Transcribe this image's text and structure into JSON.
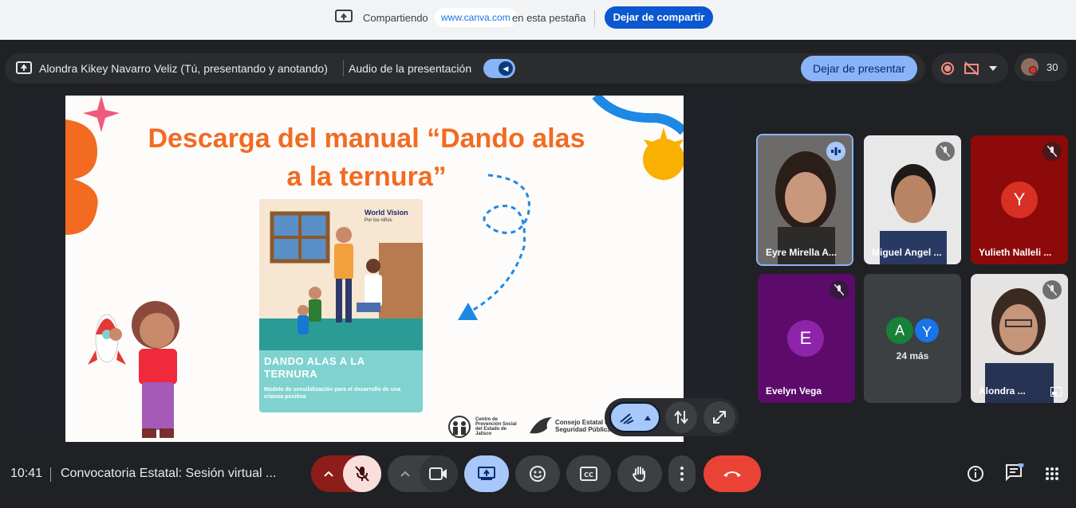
{
  "share_bar": {
    "label": "Compartiendo",
    "domain": "www.canva.com",
    "suffix": "en esta pestaña",
    "stop_button": "Dejar de compartir"
  },
  "present_bar": {
    "presenter": "Alondra Kikey Navarro Veliz (Tú, presentando y anotando)",
    "audio_label": "Audio de la presentación",
    "audio_on": true,
    "stop_button": "Dejar de presentar"
  },
  "participants_count": "30",
  "slide": {
    "title": "Descarga del manual “Dando alas a la ternura”",
    "book_brand": "World Vision",
    "book_brand_sub": "Por los niños",
    "book_title": "DANDO ALAS A LA TERNURA",
    "book_subtitle": "Modelo de sensibilización para el desarrollo de una crianza positiva",
    "logo_a": "Centro de Prevención Social del Estado de Jalisco",
    "logo_b": "Consejo Estatal de Seguridad Pública"
  },
  "tiles": [
    {
      "name": "Eyre Mirella A...",
      "state": "speaking"
    },
    {
      "name": "Miguel Angel ...",
      "state": "muted"
    },
    {
      "name": "Yulieth Nalleli ...",
      "initial": "Y",
      "state": "muted"
    },
    {
      "name": "Evelyn Vega",
      "initial": "E",
      "state": "muted"
    },
    {
      "more_label": "24 más",
      "initials": [
        "A",
        "Y"
      ]
    },
    {
      "name": "Alondra ...",
      "state": "muted"
    }
  ],
  "bottom_bar": {
    "time": "10:41",
    "meeting_title": "Convocatoria Estatal: Sesión virtual ..."
  },
  "colors": {
    "accent": "#8ab4f8",
    "primary_button": "#0b57d0",
    "end_call": "#ea4335",
    "slide_title": "#f26b21"
  }
}
